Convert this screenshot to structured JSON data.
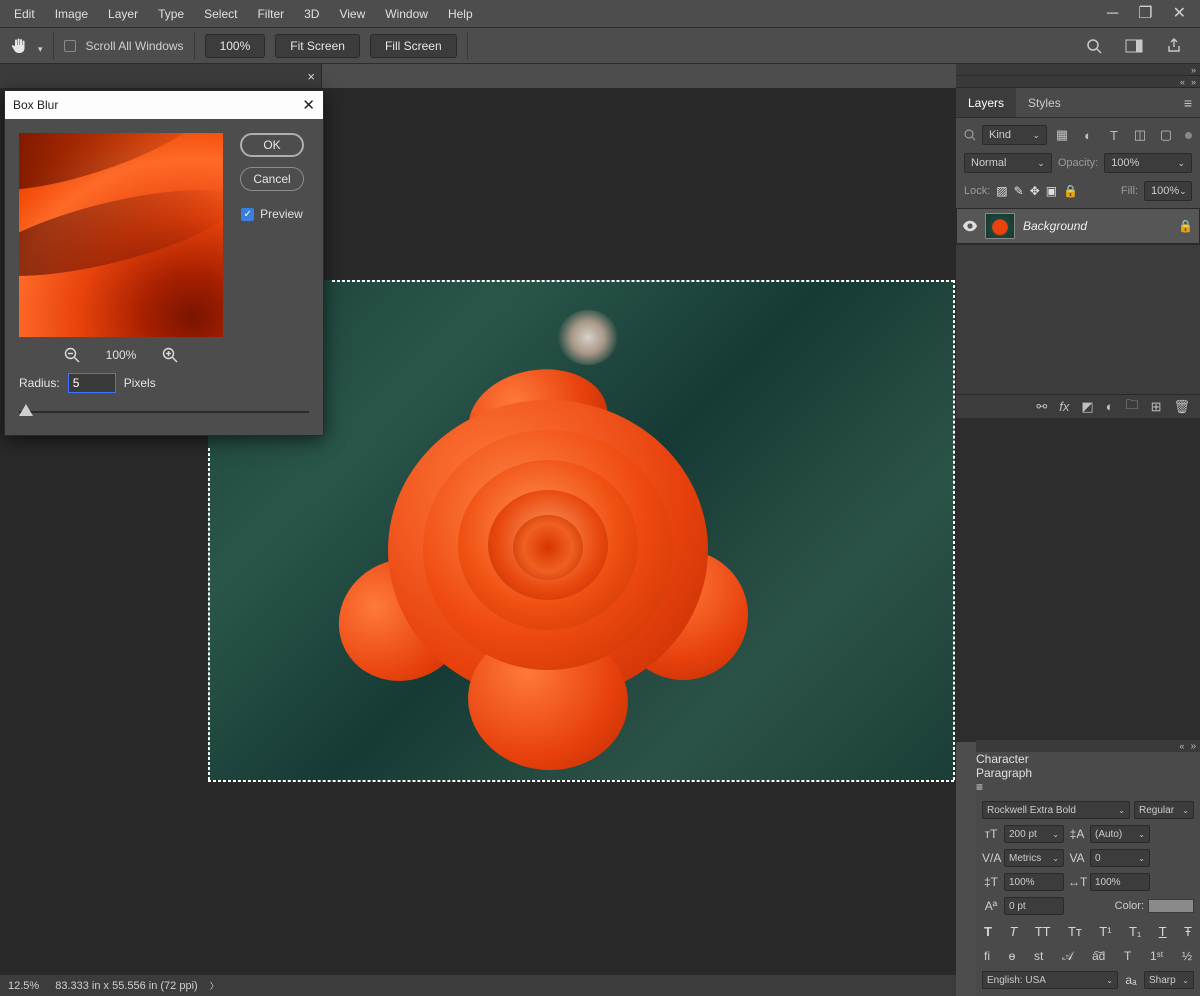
{
  "menu": {
    "items": [
      "Edit",
      "Image",
      "Layer",
      "Type",
      "Select",
      "Filter",
      "3D",
      "View",
      "Window",
      "Help"
    ]
  },
  "options": {
    "scroll_all": "Scroll All Windows",
    "zoom_pct": "100%",
    "fit": "Fit Screen",
    "fill": "Fill Screen"
  },
  "dialog": {
    "title": "Box Blur",
    "ok": "OK",
    "cancel": "Cancel",
    "preview": "Preview",
    "zoom": "100%",
    "radius_label": "Radius:",
    "radius_value": "5",
    "radius_unit": "Pixels"
  },
  "layers": {
    "tab_layers": "Layers",
    "tab_styles": "Styles",
    "kind": "Kind",
    "mode": "Normal",
    "opacity_label": "Opacity:",
    "opacity": "100%",
    "lock_label": "Lock:",
    "fill_label": "Fill:",
    "fill": "100%",
    "layer_name": "Background"
  },
  "character": {
    "tab_char": "Character",
    "tab_para": "Paragraph",
    "font": "Rockwell Extra Bold",
    "style": "Regular",
    "size": "200 pt",
    "leading": "(Auto)",
    "kerning": "Metrics",
    "tracking": "0",
    "vscale": "100%",
    "hscale": "100%",
    "baseline": "0 pt",
    "color_label": "Color:",
    "lang": "English: USA",
    "aa": "Sharp"
  },
  "status": {
    "zoom": "12.5%",
    "dims": "83.333 in x 55.556 in (72 ppi)"
  }
}
